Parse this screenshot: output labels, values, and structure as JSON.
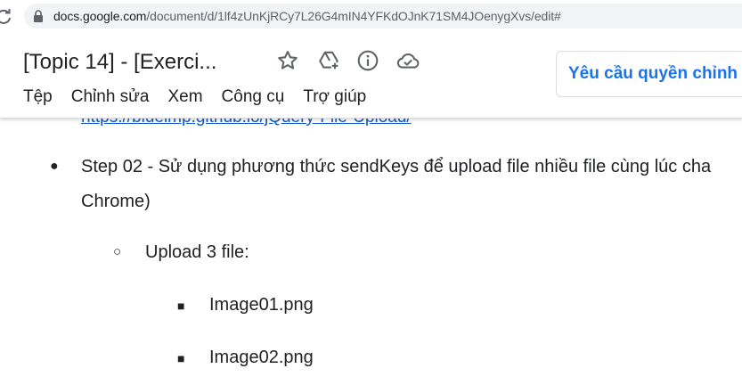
{
  "browser": {
    "url_domain": "docs.google.com",
    "url_path": "/document/d/1lf4zUnKjRCy7L26G4mIN4YFKdOJnK71SM4JOenygXvs/edit#",
    "reload_icon": "reload-icon",
    "lock_icon": "lock-icon"
  },
  "header": {
    "title": "[Topic 14] - [Exerci...",
    "icons": [
      "star-icon",
      "drive-icon",
      "info-icon",
      "cloud-icon"
    ],
    "menu": [
      "Tệp",
      "Chỉnh sửa",
      "Xem",
      "Công cụ",
      "Trợ giúp"
    ],
    "request_button_label": "Yêu cầu quyền chỉnh",
    "accent_color": "#1a73e8"
  },
  "document": {
    "cut_link_text": "https://blueimp.github.io/jQuery-File-Upload/",
    "step_line1": "Step 02 - Sử dụng phương thức sendKeys để upload file nhiều file cùng lúc cha",
    "step_line2": "Chrome)",
    "sub_item": "Upload 3 file:",
    "files": [
      "Image01.png",
      "Image02.png"
    ],
    "bullets": {
      "level1": "●",
      "level2": "○",
      "level3": "■"
    }
  }
}
